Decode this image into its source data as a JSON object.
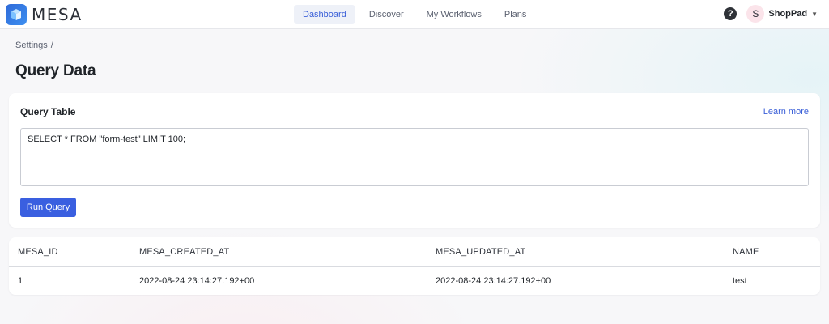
{
  "brand": {
    "name": "MESA",
    "logo_icon": "cube-icon"
  },
  "nav": {
    "tabs": [
      {
        "label": "Dashboard",
        "active": true
      },
      {
        "label": "Discover",
        "active": false
      },
      {
        "label": "My Workflows",
        "active": false
      },
      {
        "label": "Plans",
        "active": false
      }
    ]
  },
  "header": {
    "help_icon": "help-circle-icon",
    "avatar_initial": "S",
    "account_name": "ShopPad",
    "menu_icon": "caret-down-icon"
  },
  "breadcrumb": {
    "items": [
      "Settings"
    ],
    "separator": "/"
  },
  "page": {
    "title": "Query Data"
  },
  "query": {
    "title": "Query Table",
    "learn_more": "Learn more",
    "sql": "SELECT * FROM \"form-test\" LIMIT 100;",
    "run_label": "Run Query"
  },
  "results": {
    "columns": [
      "MESA_ID",
      "MESA_CREATED_AT",
      "MESA_UPDATED_AT",
      "NAME"
    ],
    "rows": [
      [
        "1",
        "2022-08-24 23:14:27.192+00",
        "2022-08-24 23:14:27.192+00",
        "test"
      ]
    ]
  },
  "colors": {
    "accent": "#3a5fe0",
    "link": "#3a5fd8",
    "active_tab_bg": "#eef1f8"
  }
}
